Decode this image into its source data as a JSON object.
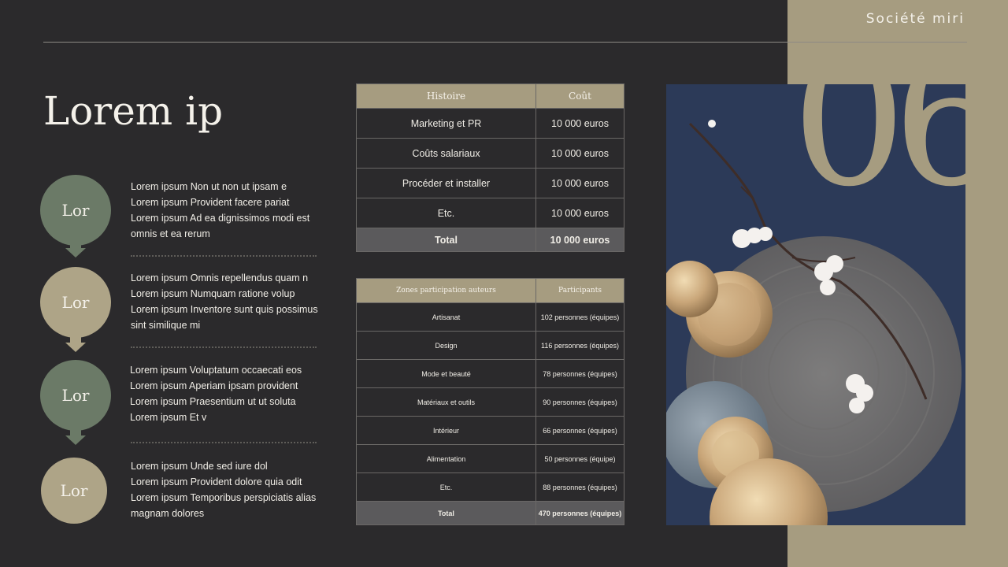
{
  "header": {
    "brand": "Société miri"
  },
  "title": "Lorem ip",
  "steps": [
    {
      "label": "Lor",
      "lines": [
        "Lorem ipsum Non ut non ut ipsam e",
        "Lorem ipsum Provident facere pariat",
        "Lorem ipsum Ad ea dignissimos modi est",
        "omnis et ea rerum"
      ]
    },
    {
      "label": "Lor",
      "lines": [
        "Lorem ipsum Omnis repellendus quam n",
        "Lorem ipsum Numquam ratione volup",
        "Lorem ipsum Inventore sunt quis possimus",
        "sint similique mi"
      ]
    },
    {
      "label": "Lor",
      "lines": [
        "Lorem ipsum Voluptatum occaecati eos",
        "Lorem ipsum Aperiam ipsam provident",
        "Lorem ipsum Praesentium ut ut soluta",
        "Lorem ipsum Et v"
      ]
    },
    {
      "label": "Lor",
      "lines": [
        "Lorem ipsum Unde sed iure dol",
        "Lorem ipsum Provident dolore quia odit",
        "Lorem ipsum Temporibus perspiciatis alias",
        "magnam dolores"
      ]
    }
  ],
  "cost_table": {
    "headers": [
      "Histoire",
      "Coût"
    ],
    "rows": [
      [
        "Marketing et PR",
        "10 000 euros"
      ],
      [
        "Coûts salariaux",
        "10 000 euros"
      ],
      [
        "Procéder et installer",
        "10 000 euros"
      ],
      [
        "Etc.",
        "10 000 euros"
      ]
    ],
    "total": [
      "Total",
      "10 000 euros"
    ]
  },
  "zones_table": {
    "headers": [
      "Zones participation auteurs",
      "Participants"
    ],
    "rows": [
      [
        "Artisanat",
        "102 personnes (équipes)"
      ],
      [
        "Design",
        "116 personnes (équipes)"
      ],
      [
        "Mode et beauté",
        "78 personnes (équipes)"
      ],
      [
        "Matériaux et outils",
        "90 personnes (équipes)"
      ],
      [
        "Intérieur",
        "66 personnes (équipes)"
      ],
      [
        "Alimentation",
        "50 personnes (équipe)"
      ],
      [
        "Etc.",
        "88 personnes (équipes)"
      ]
    ],
    "total": [
      "Total",
      "470 personnes (équipes)"
    ]
  },
  "page_number": "06",
  "colors": {
    "background": "#2b2a2c",
    "accent_tan": "#a69c80",
    "accent_green": "#6b7a67"
  }
}
